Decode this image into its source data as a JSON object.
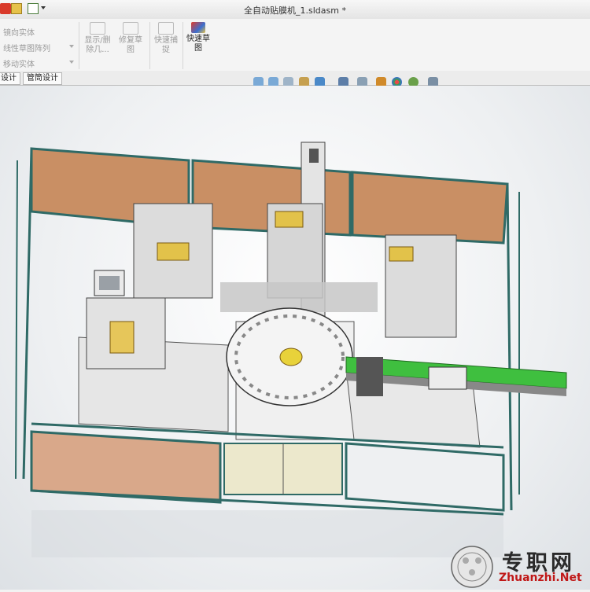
{
  "window": {
    "title": "全自动贴膜机_1.sldasm *"
  },
  "ribbon": {
    "mirror_entity": "镜向实体",
    "linear_pattern": "线性草图阵列",
    "move_entity": "移动实体",
    "show_delete_l1": "显示/删",
    "show_delete_l2": "除几...",
    "repair_sketch_l1": "修复草",
    "repair_sketch_l2": "图",
    "quick_snap_l1": "快速捕",
    "quick_snap_l2": "捉",
    "quick_sketch_l1": "快速草",
    "quick_sketch_l2": "图"
  },
  "tabs": [
    {
      "label": "设计"
    },
    {
      "label": "管筒设计"
    }
  ],
  "watermark": {
    "text": "专职网",
    "url": "Zhuanzhi.Net"
  }
}
